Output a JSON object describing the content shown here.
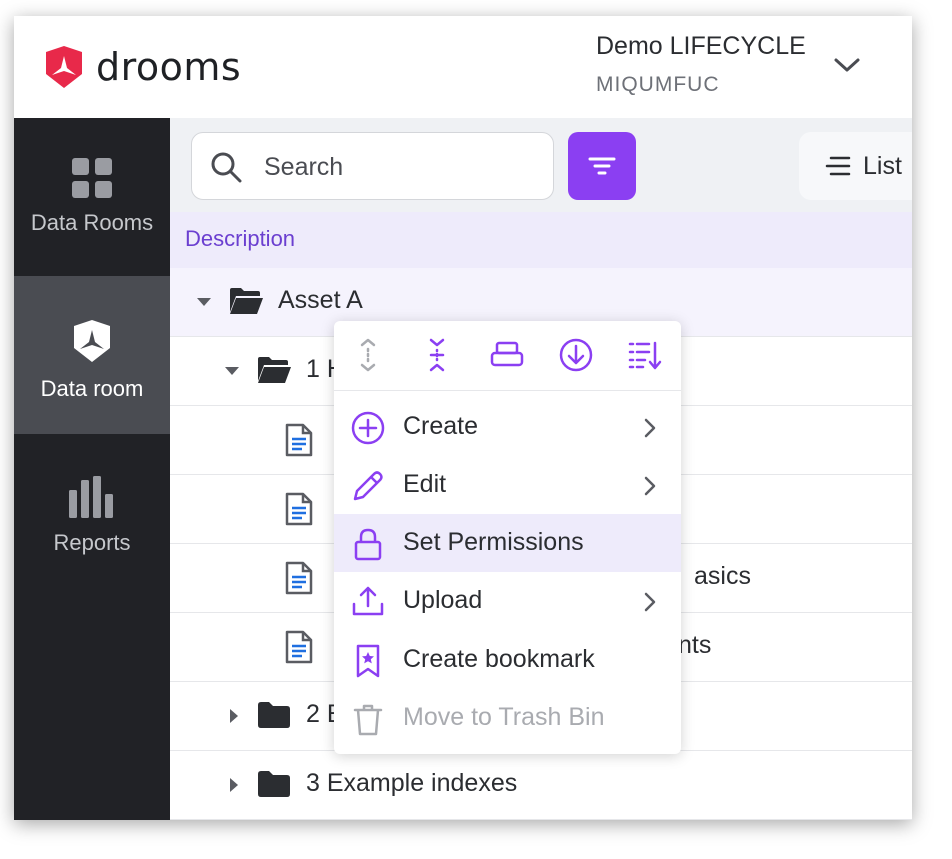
{
  "colors": {
    "accent": "#8b3ff2",
    "brand_red": "#e8294a",
    "nav_bg": "#212226",
    "nav_active_bg": "#4a4c52",
    "description_bar": "#eeebfb",
    "disabled_text": "#a9abb0"
  },
  "header": {
    "logo_text": "drooms",
    "account_name": "Demo LIFECYCLE",
    "account_code": "MIQUMFUC"
  },
  "nav": {
    "items": [
      {
        "label": "Data Rooms",
        "icon": "grid-icon"
      },
      {
        "label": "Data room",
        "icon": "drooms-shield-icon",
        "active": true
      },
      {
        "label": "Reports",
        "icon": "bar-chart-icon"
      }
    ]
  },
  "toolbar": {
    "search_placeholder": "Search",
    "filter_icon": "filter-icon",
    "view_label": "List"
  },
  "table": {
    "column_header": "Description",
    "rows": [
      {
        "label": "Asset A",
        "type": "folder",
        "expanded": true
      },
      {
        "label": "1 H",
        "type": "folder",
        "expanded": true
      },
      {
        "label": "",
        "type": "document"
      },
      {
        "label": "",
        "type": "document"
      },
      {
        "label": "asics",
        "type": "document"
      },
      {
        "label": "nts",
        "type": "document"
      },
      {
        "label": "2 E",
        "type": "folder",
        "expanded": false
      },
      {
        "label": "3 Example indexes",
        "type": "folder",
        "expanded": false
      }
    ]
  },
  "context_menu": {
    "toolbar_icons": [
      "expand-vertical-icon",
      "collapse-vertical-icon",
      "print-icon",
      "download-icon",
      "sort-list-icon"
    ],
    "items": [
      {
        "label": "Create",
        "icon": "plus-circle-icon",
        "submenu": true
      },
      {
        "label": "Edit",
        "icon": "pencil-icon",
        "submenu": true
      },
      {
        "label": "Set Permissions",
        "icon": "lock-icon",
        "submenu": false,
        "highlighted": true
      },
      {
        "label": "Upload",
        "icon": "upload-icon",
        "submenu": true
      },
      {
        "label": "Create bookmark",
        "icon": "bookmark-icon",
        "submenu": false
      },
      {
        "label": "Move to Trash Bin",
        "icon": "trash-icon",
        "submenu": false,
        "disabled": true
      }
    ]
  }
}
